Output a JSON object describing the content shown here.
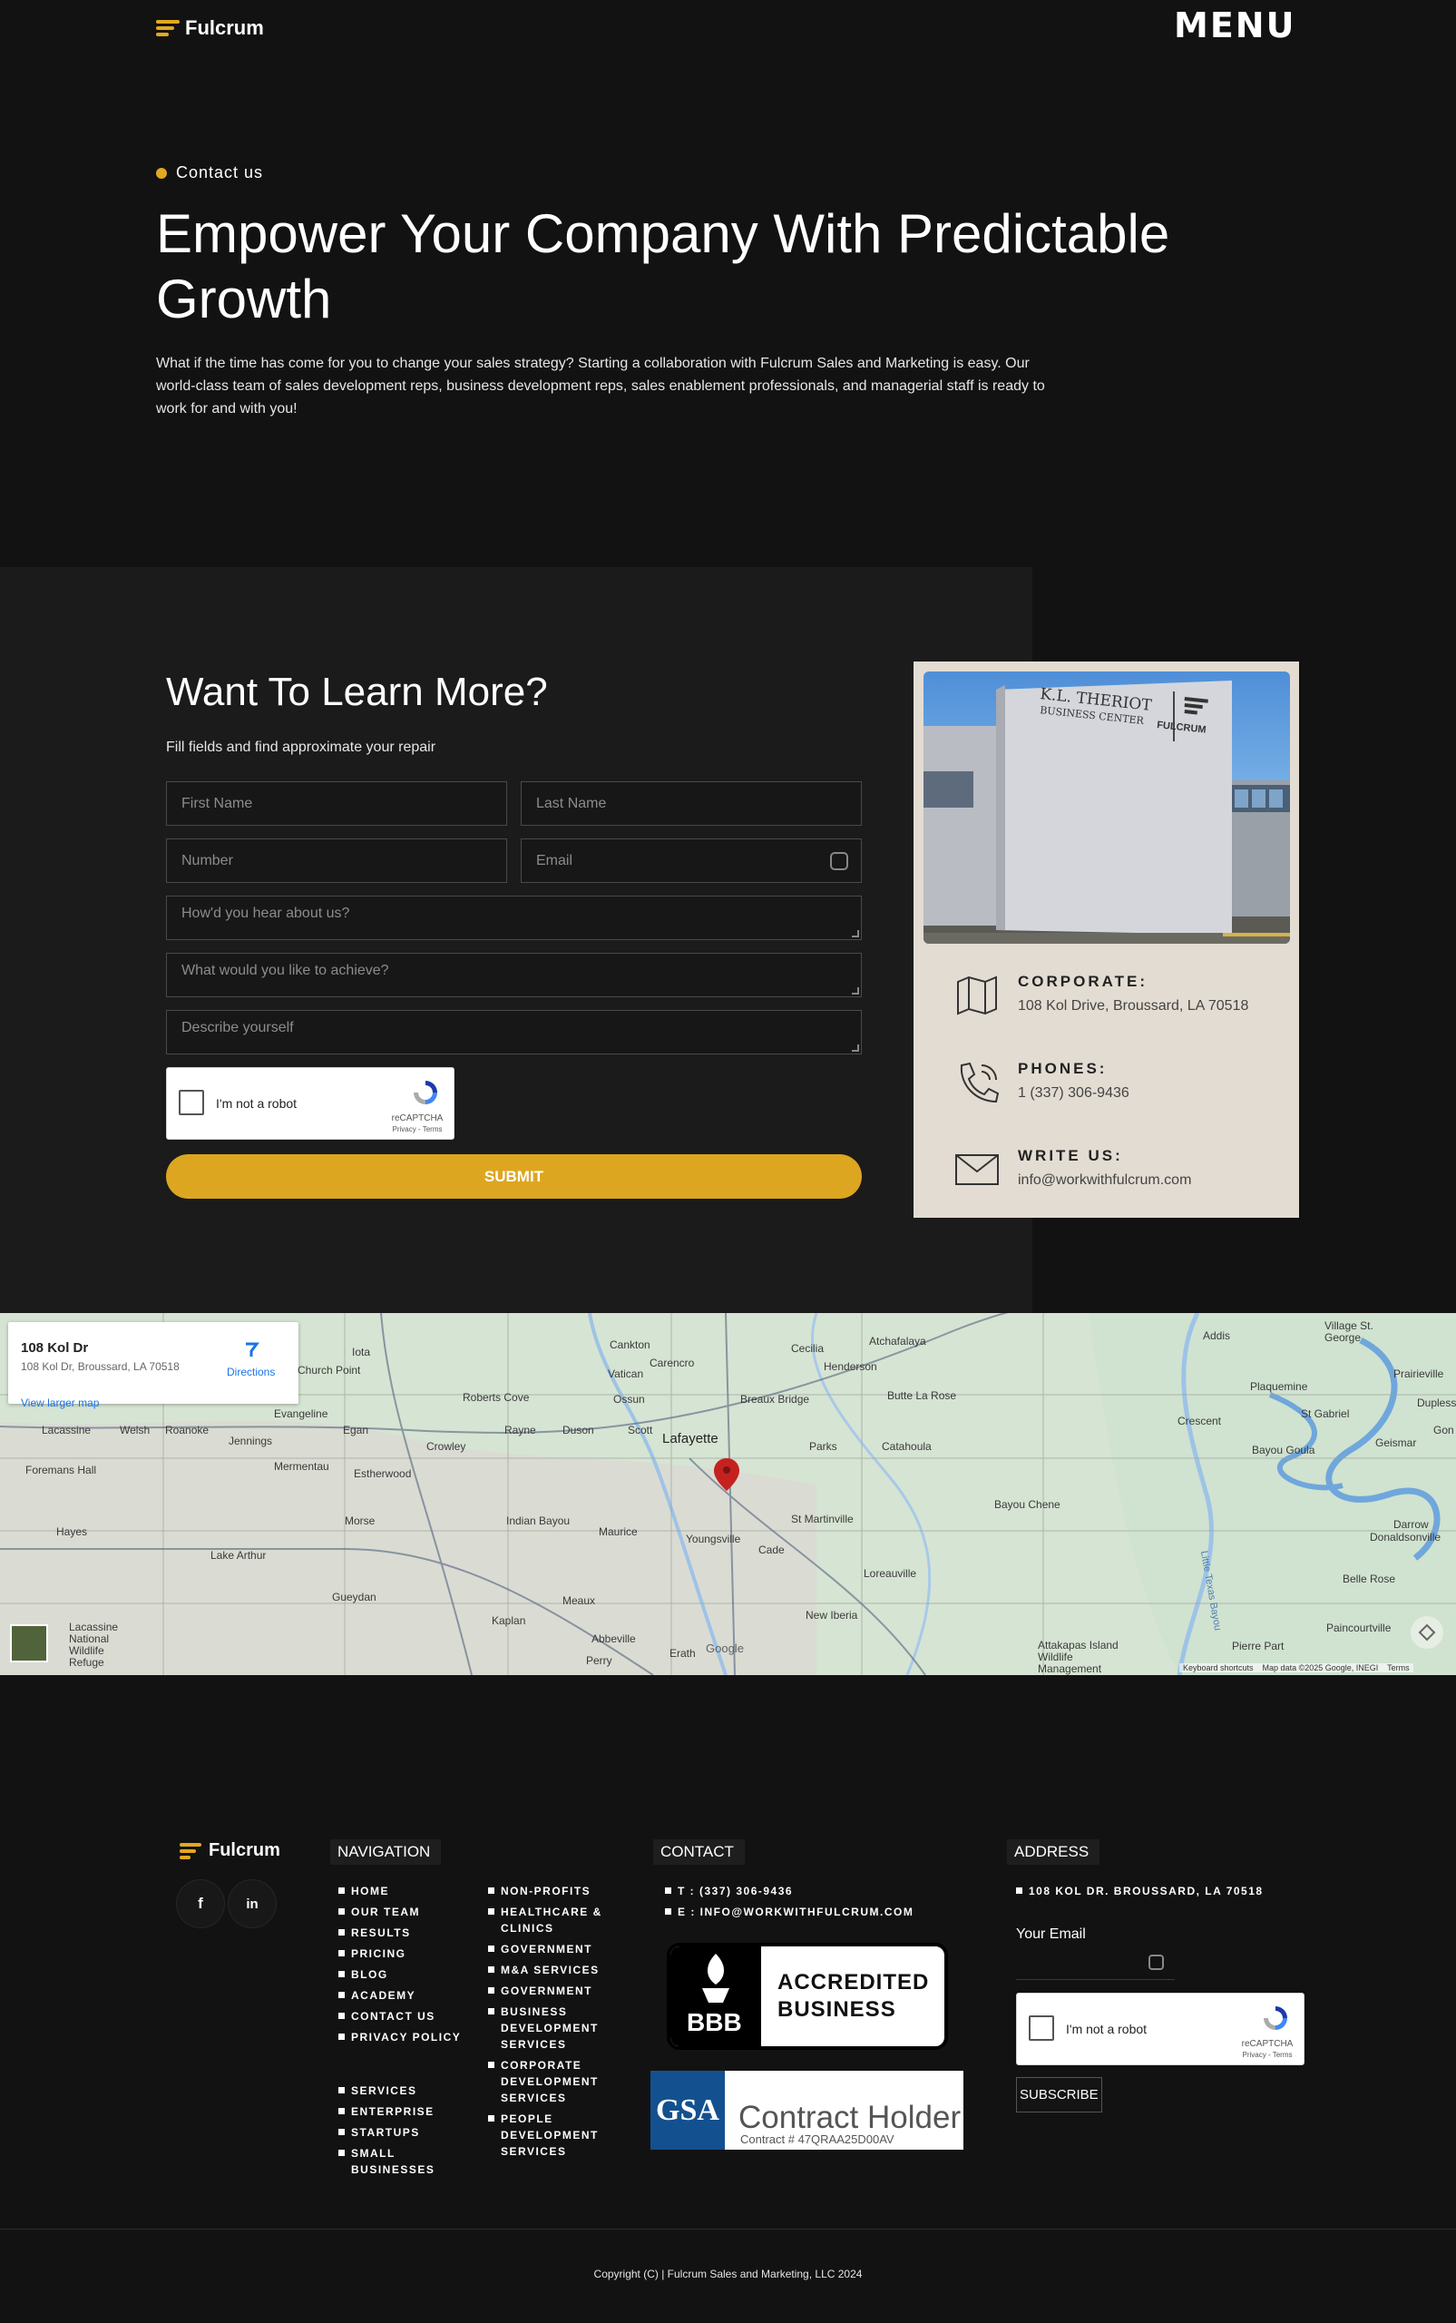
{
  "header": {
    "brand": "Fulcrum",
    "menu_label": "MENU"
  },
  "hero": {
    "eyebrow": "Contact us",
    "title": "Empower Your Company With Predictable Growth",
    "text": "What if the time has come for you to change your sales strategy? Starting a collaboration with Fulcrum Sales and Marketing is easy. Our world-class team of sales development reps, business development reps, sales enablement professionals, and managerial staff is ready to work for and with you!"
  },
  "form": {
    "title": "Want To Learn More?",
    "subtitle": "Fill fields and find approximate your repair",
    "fields": {
      "first_name": "First Name",
      "last_name": "Last Name",
      "number": "Number",
      "email": "Email",
      "hear": "How'd you hear about us?",
      "achieve": "What would you like to achieve?",
      "describe": "Describe yourself"
    },
    "recaptcha": {
      "label": "I'm not a robot",
      "brand": "reCAPTCHA",
      "terms": "Privacy - Terms"
    },
    "submit": "SUBMIT"
  },
  "info": {
    "photo_sign_line1": "K.L. THERIOT",
    "photo_sign_line2": "BUSINESS CENTER",
    "photo_sign_brand": "FULCRUM",
    "corporate_label": "CORPORATE:",
    "corporate_value": "108 Kol Drive, Broussard, LA 70518",
    "phones_label": "PHONES:",
    "phones_value": "1 (337) 306-9436",
    "write_label": "WRITE US:",
    "write_value": "info@workwithfulcrum.com"
  },
  "map": {
    "place_name": "108 Kol Dr",
    "place_address": "108 Kol Dr, Broussard, LA 70518",
    "directions": "Directions",
    "larger_map": "View larger map",
    "attribution": "Keyboard shortcuts    Map data ©2025 Google, INEGI    Terms",
    "google": "Google",
    "towns": {
      "lafayette": "Lafayette",
      "iota": "Iota",
      "church_point": "Church Point",
      "cankton": "Cankton",
      "cecilia": "Cecilia",
      "atchafalaya": "Atchafalaya",
      "carencro": "Carencro",
      "henderson": "Henderson",
      "vatican": "Vatican",
      "ossun": "Ossun",
      "breaux_bridge": "Breaux Bridge",
      "butte_la_rose": "Butte La Rose",
      "evangeline": "Evangeline",
      "roberts_cove": "Roberts Cove",
      "egan": "Egan",
      "rayne": "Rayne",
      "duson": "Duson",
      "scott": "Scott",
      "parks": "Parks",
      "catahoula": "Catahoula",
      "lacassine": "Lacassine",
      "welsh": "Welsh",
      "roanoke": "Roanoke",
      "jennings": "Jennings",
      "crowley": "Crowley",
      "mermentau": "Mermentau",
      "estherwood": "Estherwood",
      "foremans_hall": "Foremans Hall",
      "morse": "Morse",
      "indian_bayou": "Indian Bayou",
      "maurice": "Maurice",
      "st_martinville": "St Martinville",
      "bayou_chene": "Bayou Chene",
      "youngsville": "Youngsville",
      "cade": "Cade",
      "hayes": "Hayes",
      "lake_arthur": "Lake Arthur",
      "loreauville": "Loreauville",
      "gueydan": "Gueydan",
      "meaux": "Meaux",
      "kaplan": "Kaplan",
      "new_iberia": "New Iberia",
      "abbeville": "Abbeville",
      "erath": "Erath",
      "perry": "Perry",
      "attakapas": "Attakapas Island Wildlife Management",
      "lacassine_refuge": "Lacassine National Wildlife Refuge",
      "addis": "Addis",
      "village_st_george": "Village St. George",
      "plaquemine": "Plaquemine",
      "crescent": "Crescent",
      "st_gabriel": "St Gabriel",
      "bayou_goula": "Bayou Goula",
      "geismar": "Geismar",
      "gonzales": "Gon",
      "prairieville": "Prairieville",
      "duplessis": "Dupless",
      "darrow": "Darrow",
      "donaldsonville": "Donaldsonville",
      "belle_rose": "Belle Rose",
      "paincourtville": "Paincourtville",
      "pierre_part": "Pierre Part",
      "little_bayou": "Little Texas Bayou"
    }
  },
  "footer": {
    "brand": "Fulcrum",
    "social": {
      "facebook": "f",
      "linkedin": "in"
    },
    "navigation_heading": "NAVIGATION",
    "nav_col1": [
      "HOME",
      "OUR TEAM",
      "RESULTS",
      "PRICING",
      "BLOG",
      "ACADEMY",
      "CONTACT US",
      "PRIVACY POLICY"
    ],
    "nav_col1b": [
      "SERVICES",
      "ENTERPRISE",
      "STARTUPS",
      "SMALL BUSINESSES"
    ],
    "nav_col2": [
      "NON-PROFITS",
      "HEALTHCARE & CLINICS",
      "GOVERNMENT",
      "M&A SERVICES",
      "GOVERNMENT",
      "BUSINESS DEVELOPMENT SERVICES",
      "CORPORATE DEVELOPMENT SERVICES",
      "PEOPLE DEVELOPMENT SERVICES"
    ],
    "contact_heading": "CONTACT",
    "contact_phone": "T : (337) 306-9436",
    "contact_email": "E : INFO@WORKWITHFULCRUM.COM",
    "bbb_line1": "ACCREDITED",
    "bbb_line2": "BUSINESS",
    "bbb_logo": "BBB",
    "gsa_logo": "GSA",
    "gsa_title": "Contract Holder",
    "gsa_contract": "Contract # 47QRAA25D00AV",
    "address_heading": "ADDRESS",
    "address_value": "108 KOL DR. BROUSSARD, LA 70518",
    "email_label": "Your Email",
    "subscribe": "SUBSCRIBE",
    "copyright": "Copyright (C) | Fulcrum Sales and Marketing, LLC 2024"
  },
  "colors": {
    "accent": "#dda620",
    "background": "#131212",
    "card": "#e3dcd2"
  }
}
